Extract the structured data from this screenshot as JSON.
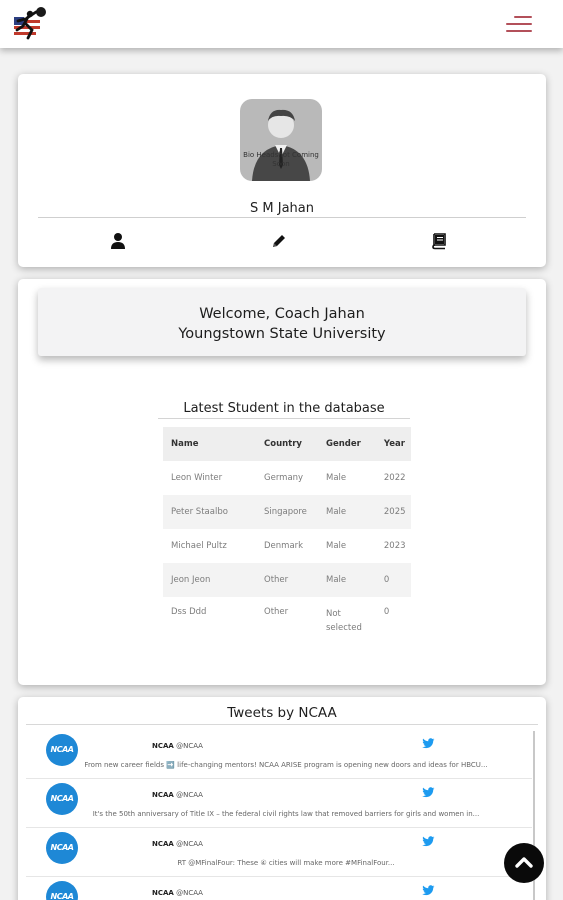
{
  "nav": {
    "logo_icon": "basketball-player-flag-logo",
    "menu_icon": "hamburger-menu-icon",
    "accent_color": "#b3505a"
  },
  "profile": {
    "avatar_caption": "Bio Headshot Coming Soon",
    "name": "S M Jahan",
    "actions": [
      {
        "icon": "user-icon"
      },
      {
        "icon": "pencil-icon"
      },
      {
        "icon": "book-icon"
      }
    ]
  },
  "welcome": {
    "line1": "Welcome, Coach Jahan",
    "line2": "Youngstown State University"
  },
  "students": {
    "title": "Latest Student in the database",
    "columns": [
      "Name",
      "Country",
      "Gender",
      "Year"
    ],
    "rows": [
      {
        "name": "Leon Winter",
        "country": "Germany",
        "gender": "Male",
        "year": "2022"
      },
      {
        "name": "Peter Staalbo",
        "country": "Singapore",
        "gender": "Male",
        "year": "2025"
      },
      {
        "name": "Michael Pultz",
        "country": "Denmark",
        "gender": "Male",
        "year": "2023"
      },
      {
        "name": "Jeon Jeon",
        "country": "Other",
        "gender": "Male",
        "year": "0"
      },
      {
        "name": "Dss Ddd",
        "country": "Other",
        "gender": "Not selected",
        "year": "0"
      }
    ]
  },
  "tweets": {
    "title": "Tweets by NCAA",
    "logo_text": "NCAA",
    "items": [
      {
        "author": "NCAA",
        "handle": "@NCAA",
        "text": "From new career fields ➡️ life-changing mentors! NCAA ARISE program is opening new doors and ideas for HBCU..."
      },
      {
        "author": "NCAA",
        "handle": "@NCAA",
        "text": "It's the 50th anniversary of Title IX – the federal civil rights law that removed barriers for girls and women in..."
      },
      {
        "author": "NCAA",
        "handle": "@NCAA",
        "text": "RT @MFinalFour: These ④ cities will make more #MFinalFour..."
      },
      {
        "author": "NCAA",
        "handle": "@NCAA",
        "text": ""
      }
    ]
  },
  "scroll_top_icon": "chevron-up-icon"
}
